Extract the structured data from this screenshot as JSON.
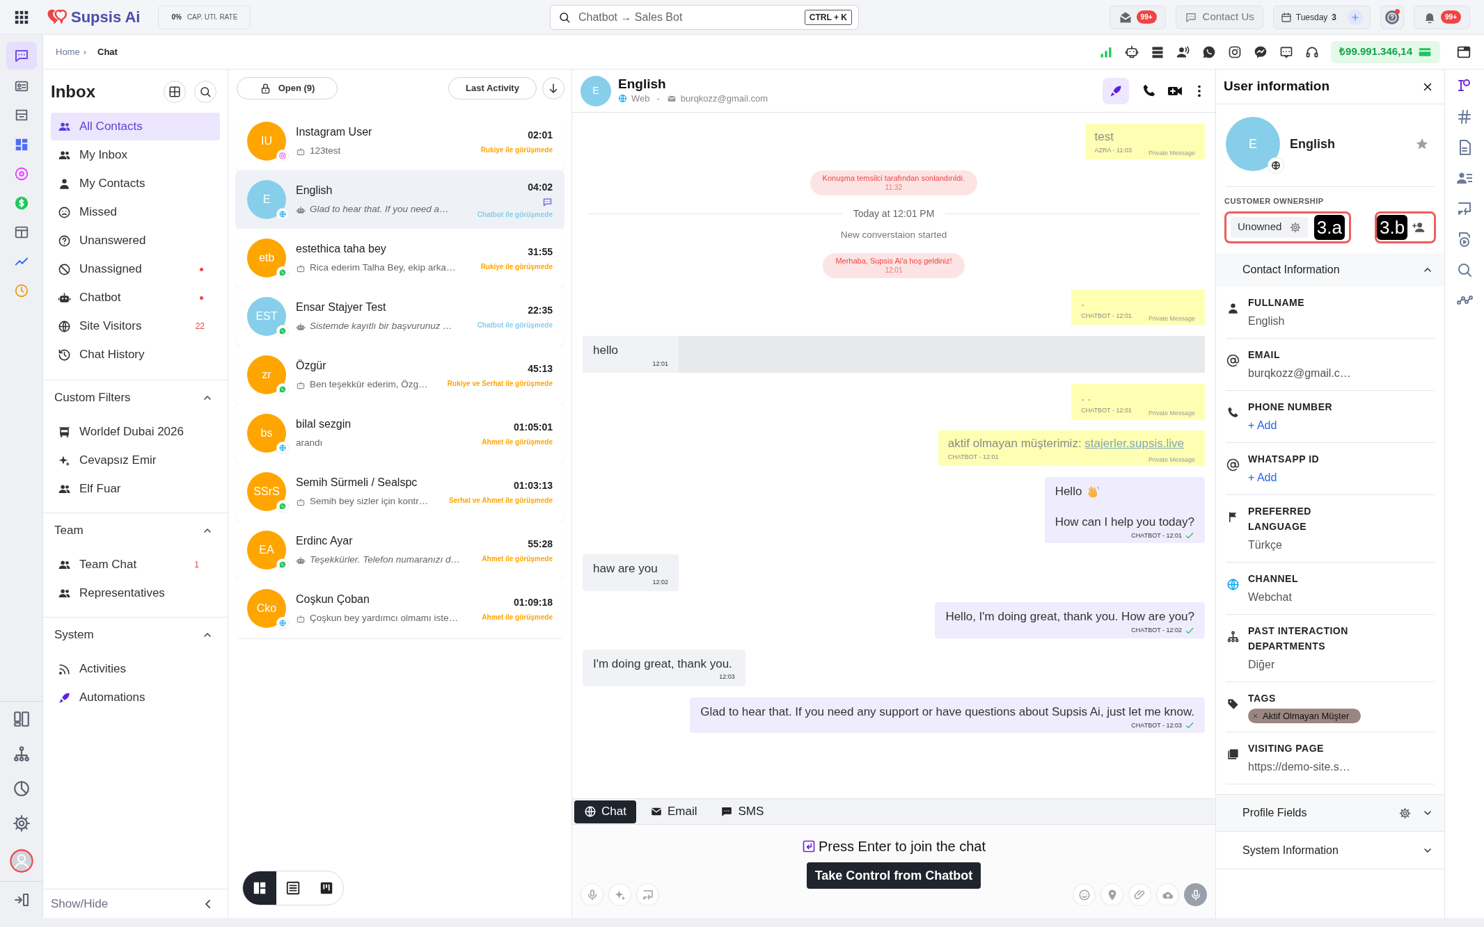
{
  "top_bar": {
    "logo": "Supsis Ai",
    "capacity": {
      "value": "0%",
      "label": "CAP. UTI. RATE"
    },
    "search": {
      "placeholder": "Chatbot → Sales Bot",
      "shortcut": "CTRL + K"
    },
    "messages_badge": "99+",
    "contact_us": "Contact Us",
    "date": {
      "day": "Tuesday",
      "number": "3"
    },
    "help_alert": true,
    "notifications_badge": "99+"
  },
  "breadcrumb": {
    "separator": "›",
    "items": [
      {
        "label": "Home",
        "selected": false
      },
      {
        "label": "Chat",
        "selected": true
      }
    ]
  },
  "balance": "₺99.991.346,14",
  "inbox": {
    "title": "Inbox",
    "items": [
      {
        "label": "All Contacts",
        "selected": true,
        "alert": false
      },
      {
        "label": "My Inbox",
        "selected": false,
        "alert": false
      },
      {
        "label": "My Contacts",
        "selected": false,
        "alert": false
      },
      {
        "label": "Missed",
        "selected": false,
        "alert": false
      },
      {
        "label": "Unanswered",
        "selected": false,
        "alert": false
      },
      {
        "label": "Unassigned",
        "selected": false,
        "alert": true
      },
      {
        "label": "Chatbot",
        "selected": false,
        "alert": true
      },
      {
        "label": "Site Visitors",
        "selected": false,
        "alert": false,
        "count": "22"
      },
      {
        "label": "Chat History",
        "selected": false,
        "alert": false
      }
    ],
    "sections": [
      {
        "title": "Custom Filters",
        "expanded": true,
        "items": [
          {
            "label": "Worldef Dubai 2026"
          },
          {
            "label": "Cevapsız Emir"
          },
          {
            "label": "Elf Fuar"
          }
        ]
      },
      {
        "title": "Team",
        "expanded": true,
        "items": [
          {
            "label": "Team Chat",
            "count": "1"
          },
          {
            "label": "Representatives"
          }
        ]
      },
      {
        "title": "System",
        "expanded": true,
        "items": [
          {
            "label": "Activities"
          },
          {
            "label": "Automations"
          }
        ]
      }
    ],
    "show_hide": "Show/Hide"
  },
  "conversations": {
    "filter": "Open (9)",
    "sort": "Last Activity",
    "items": [
      {
        "initials": "IU",
        "name": "Instagram User",
        "preview": "123test",
        "italic": false,
        "bot": true,
        "time": "02:01",
        "status": "Rukiye ile görüşmede",
        "color": "#ffa500",
        "selected": false,
        "unread": false
      },
      {
        "initials": "E",
        "name": "English",
        "preview": "Glad to hear that. If you need a…",
        "italic": true,
        "bot": true,
        "time": "04:02",
        "status": "Chatbot ile görüşmede",
        "color": "#87ceeb",
        "selected": true,
        "unread": true
      },
      {
        "initials": "etb",
        "name": "estethica taha bey",
        "preview": "Rica ederim Talha Bey, ekip arka…",
        "italic": false,
        "bot": true,
        "time": "31:55",
        "status": "Rukiye ile görüşmede",
        "color": "#ffa500",
        "selected": false,
        "unread": false
      },
      {
        "initials": "EST",
        "name": "Ensar Stajyer Test",
        "preview": "Sistemde kayıtlı bir başvurunuz …",
        "italic": true,
        "bot": true,
        "time": "22:35",
        "status": "Chatbot ile görüşmede",
        "color": "#87ceeb",
        "selected": false,
        "unread": false
      },
      {
        "initials": "zr",
        "name": "Özgür",
        "preview": "Ben teşekkür ederim, Özg…",
        "italic": false,
        "bot": true,
        "time": "45:13",
        "status": "Rukiye ve Serhat ile görüşmede",
        "color": "#ffa500",
        "selected": false,
        "unread": false
      },
      {
        "initials": "bs",
        "name": "bilal sezgin",
        "preview": "arandı",
        "italic": false,
        "bot": false,
        "time": "01:05:01",
        "status": "Ahmet ile görüşmede",
        "color": "#ffa500",
        "selected": false,
        "unread": false
      },
      {
        "initials": "SSrS",
        "name": "Semih Sürmeli / Sealspc",
        "preview": "Semih bey sizler için kontr…",
        "italic": false,
        "bot": true,
        "time": "01:03:13",
        "status": "Serhat ve Ahmet ile görüşmede",
        "color": "#ffa500",
        "selected": false,
        "unread": false
      },
      {
        "initials": "EA",
        "name": "Erdinc Ayar",
        "preview": "Teşekkürler. Telefon numaranızı d…",
        "italic": true,
        "bot": true,
        "time": "55:28",
        "status": "Ahmet ile görüşmede",
        "color": "#ffa500",
        "selected": false,
        "unread": false
      },
      {
        "initials": "Cko",
        "name": "Coşkun Çoban",
        "preview": "Çoşkun bey yardımcı olmamı iste…",
        "italic": false,
        "bot": true,
        "time": "01:09:18",
        "status": "Ahmet ile görüşmede",
        "color": "#ffa500",
        "selected": false,
        "unread": false
      }
    ],
    "views": [
      {
        "selected": true
      },
      {
        "selected": false
      },
      {
        "selected": false
      }
    ]
  },
  "chat": {
    "contact": {
      "initial": "E",
      "name": "English",
      "channel": "Web",
      "separator": "-",
      "email": "burqkozz@gmail.com"
    },
    "messages": [
      {
        "kind": "private",
        "text": "test",
        "meta": "AZRA - 11:03",
        "label": "Private Message"
      },
      {
        "kind": "system",
        "text": "Konuşma temsilci tarafından sonlandırıldı.",
        "time": "11:32"
      },
      {
        "kind": "divider",
        "text": "Today at 12:01 PM"
      },
      {
        "kind": "notice",
        "text": "New converstaion started"
      },
      {
        "kind": "system",
        "text": "Merhaba, Supsis Ai'a hoş geldiniz!",
        "time": "12:01"
      },
      {
        "kind": "private",
        "text": ".",
        "meta": "CHATBOT - 12:01",
        "label": "Private Message"
      },
      {
        "kind": "incoming",
        "text": "hello",
        "time": "12:01",
        "highlighted": true
      },
      {
        "kind": "private",
        "text": ". .",
        "meta": "CHATBOT - 12:01",
        "label": "Private Message"
      },
      {
        "kind": "private",
        "text": "aktif olmayan müşterimiz:",
        "link": "stajerler.supsis.live",
        "meta": "CHATBOT - 12:01",
        "label": "Private Message"
      },
      {
        "kind": "outgoing",
        "lines": [
          "Hello",
          "How can I help you today?"
        ],
        "wave": true,
        "meta": "CHATBOT - 12:01",
        "delivered": true
      },
      {
        "kind": "incoming",
        "text": "haw are you",
        "time": "12:02",
        "highlighted": false
      },
      {
        "kind": "outgoing",
        "lines": [
          "Hello, I'm doing great, thank you. How are you?"
        ],
        "wave": false,
        "meta": "CHATBOT - 12:02",
        "delivered": true
      },
      {
        "kind": "incoming",
        "text": "I'm doing great, thank you.",
        "time": "12:03",
        "highlighted": false
      },
      {
        "kind": "outgoing",
        "lines": [
          "Glad to hear that. If you need any support or have questions about Supsis Ai, just let me know."
        ],
        "wave": false,
        "meta": "CHATBOT - 12:03",
        "delivered": true
      }
    ],
    "composer_tabs": [
      {
        "label": "Chat",
        "selected": true
      },
      {
        "label": "Email",
        "selected": false
      },
      {
        "label": "SMS",
        "selected": false
      }
    ],
    "join_hint": "Press Enter to join the chat",
    "take_control": "Take Control from Chatbot"
  },
  "user_info": {
    "title": "User information",
    "initial": "E",
    "name": "English",
    "ownership_label": "CUSTOMER OWNERSHIP",
    "ownership": "Unowned",
    "callouts": [
      "3.a",
      "3.b"
    ],
    "contact_section": {
      "title": "Contact Information",
      "expanded": true,
      "fields": [
        {
          "kind": "value",
          "label": "FULLNAME",
          "value": "English"
        },
        {
          "kind": "value",
          "label": "EMAIL",
          "value": "burqkozz@gmail.c…"
        },
        {
          "kind": "add",
          "label": "PHONE NUMBER",
          "value": "+ Add"
        },
        {
          "kind": "add",
          "label": "WHATSAPP ID",
          "value": "+ Add"
        },
        {
          "kind": "value",
          "label": "PREFERRED LANGUAGE",
          "value": "Türkçe"
        },
        {
          "kind": "value",
          "label": "CHANNEL",
          "value": "Webchat"
        },
        {
          "kind": "value",
          "label": "PAST INTERACTION DEPARTMENTS",
          "value": "Diğer"
        },
        {
          "kind": "tag",
          "label": "TAGS",
          "value": "Aktif Olmayan Müşter"
        },
        {
          "kind": "value",
          "label": "VISITING PAGE",
          "value": "https://demo-site.s…"
        }
      ]
    },
    "sections": [
      {
        "title": "Profile Fields",
        "expanded": false
      },
      {
        "title": "System Information",
        "expanded": false
      }
    ]
  }
}
